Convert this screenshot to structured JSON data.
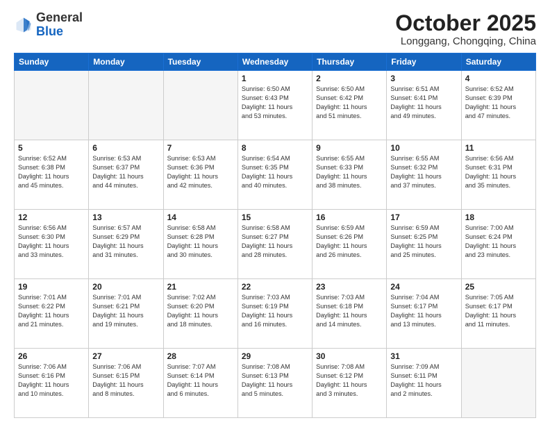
{
  "header": {
    "logo_general": "General",
    "logo_blue": "Blue",
    "month": "October 2025",
    "location": "Longgang, Chongqing, China"
  },
  "weekdays": [
    "Sunday",
    "Monday",
    "Tuesday",
    "Wednesday",
    "Thursday",
    "Friday",
    "Saturday"
  ],
  "weeks": [
    [
      {
        "day": "",
        "info": ""
      },
      {
        "day": "",
        "info": ""
      },
      {
        "day": "",
        "info": ""
      },
      {
        "day": "1",
        "info": "Sunrise: 6:50 AM\nSunset: 6:43 PM\nDaylight: 11 hours\nand 53 minutes."
      },
      {
        "day": "2",
        "info": "Sunrise: 6:50 AM\nSunset: 6:42 PM\nDaylight: 11 hours\nand 51 minutes."
      },
      {
        "day": "3",
        "info": "Sunrise: 6:51 AM\nSunset: 6:41 PM\nDaylight: 11 hours\nand 49 minutes."
      },
      {
        "day": "4",
        "info": "Sunrise: 6:52 AM\nSunset: 6:39 PM\nDaylight: 11 hours\nand 47 minutes."
      }
    ],
    [
      {
        "day": "5",
        "info": "Sunrise: 6:52 AM\nSunset: 6:38 PM\nDaylight: 11 hours\nand 45 minutes."
      },
      {
        "day": "6",
        "info": "Sunrise: 6:53 AM\nSunset: 6:37 PM\nDaylight: 11 hours\nand 44 minutes."
      },
      {
        "day": "7",
        "info": "Sunrise: 6:53 AM\nSunset: 6:36 PM\nDaylight: 11 hours\nand 42 minutes."
      },
      {
        "day": "8",
        "info": "Sunrise: 6:54 AM\nSunset: 6:35 PM\nDaylight: 11 hours\nand 40 minutes."
      },
      {
        "day": "9",
        "info": "Sunrise: 6:55 AM\nSunset: 6:33 PM\nDaylight: 11 hours\nand 38 minutes."
      },
      {
        "day": "10",
        "info": "Sunrise: 6:55 AM\nSunset: 6:32 PM\nDaylight: 11 hours\nand 37 minutes."
      },
      {
        "day": "11",
        "info": "Sunrise: 6:56 AM\nSunset: 6:31 PM\nDaylight: 11 hours\nand 35 minutes."
      }
    ],
    [
      {
        "day": "12",
        "info": "Sunrise: 6:56 AM\nSunset: 6:30 PM\nDaylight: 11 hours\nand 33 minutes."
      },
      {
        "day": "13",
        "info": "Sunrise: 6:57 AM\nSunset: 6:29 PM\nDaylight: 11 hours\nand 31 minutes."
      },
      {
        "day": "14",
        "info": "Sunrise: 6:58 AM\nSunset: 6:28 PM\nDaylight: 11 hours\nand 30 minutes."
      },
      {
        "day": "15",
        "info": "Sunrise: 6:58 AM\nSunset: 6:27 PM\nDaylight: 11 hours\nand 28 minutes."
      },
      {
        "day": "16",
        "info": "Sunrise: 6:59 AM\nSunset: 6:26 PM\nDaylight: 11 hours\nand 26 minutes."
      },
      {
        "day": "17",
        "info": "Sunrise: 6:59 AM\nSunset: 6:25 PM\nDaylight: 11 hours\nand 25 minutes."
      },
      {
        "day": "18",
        "info": "Sunrise: 7:00 AM\nSunset: 6:24 PM\nDaylight: 11 hours\nand 23 minutes."
      }
    ],
    [
      {
        "day": "19",
        "info": "Sunrise: 7:01 AM\nSunset: 6:22 PM\nDaylight: 11 hours\nand 21 minutes."
      },
      {
        "day": "20",
        "info": "Sunrise: 7:01 AM\nSunset: 6:21 PM\nDaylight: 11 hours\nand 19 minutes."
      },
      {
        "day": "21",
        "info": "Sunrise: 7:02 AM\nSunset: 6:20 PM\nDaylight: 11 hours\nand 18 minutes."
      },
      {
        "day": "22",
        "info": "Sunrise: 7:03 AM\nSunset: 6:19 PM\nDaylight: 11 hours\nand 16 minutes."
      },
      {
        "day": "23",
        "info": "Sunrise: 7:03 AM\nSunset: 6:18 PM\nDaylight: 11 hours\nand 14 minutes."
      },
      {
        "day": "24",
        "info": "Sunrise: 7:04 AM\nSunset: 6:17 PM\nDaylight: 11 hours\nand 13 minutes."
      },
      {
        "day": "25",
        "info": "Sunrise: 7:05 AM\nSunset: 6:17 PM\nDaylight: 11 hours\nand 11 minutes."
      }
    ],
    [
      {
        "day": "26",
        "info": "Sunrise: 7:06 AM\nSunset: 6:16 PM\nDaylight: 11 hours\nand 10 minutes."
      },
      {
        "day": "27",
        "info": "Sunrise: 7:06 AM\nSunset: 6:15 PM\nDaylight: 11 hours\nand 8 minutes."
      },
      {
        "day": "28",
        "info": "Sunrise: 7:07 AM\nSunset: 6:14 PM\nDaylight: 11 hours\nand 6 minutes."
      },
      {
        "day": "29",
        "info": "Sunrise: 7:08 AM\nSunset: 6:13 PM\nDaylight: 11 hours\nand 5 minutes."
      },
      {
        "day": "30",
        "info": "Sunrise: 7:08 AM\nSunset: 6:12 PM\nDaylight: 11 hours\nand 3 minutes."
      },
      {
        "day": "31",
        "info": "Sunrise: 7:09 AM\nSunset: 6:11 PM\nDaylight: 11 hours\nand 2 minutes."
      },
      {
        "day": "",
        "info": ""
      }
    ]
  ]
}
